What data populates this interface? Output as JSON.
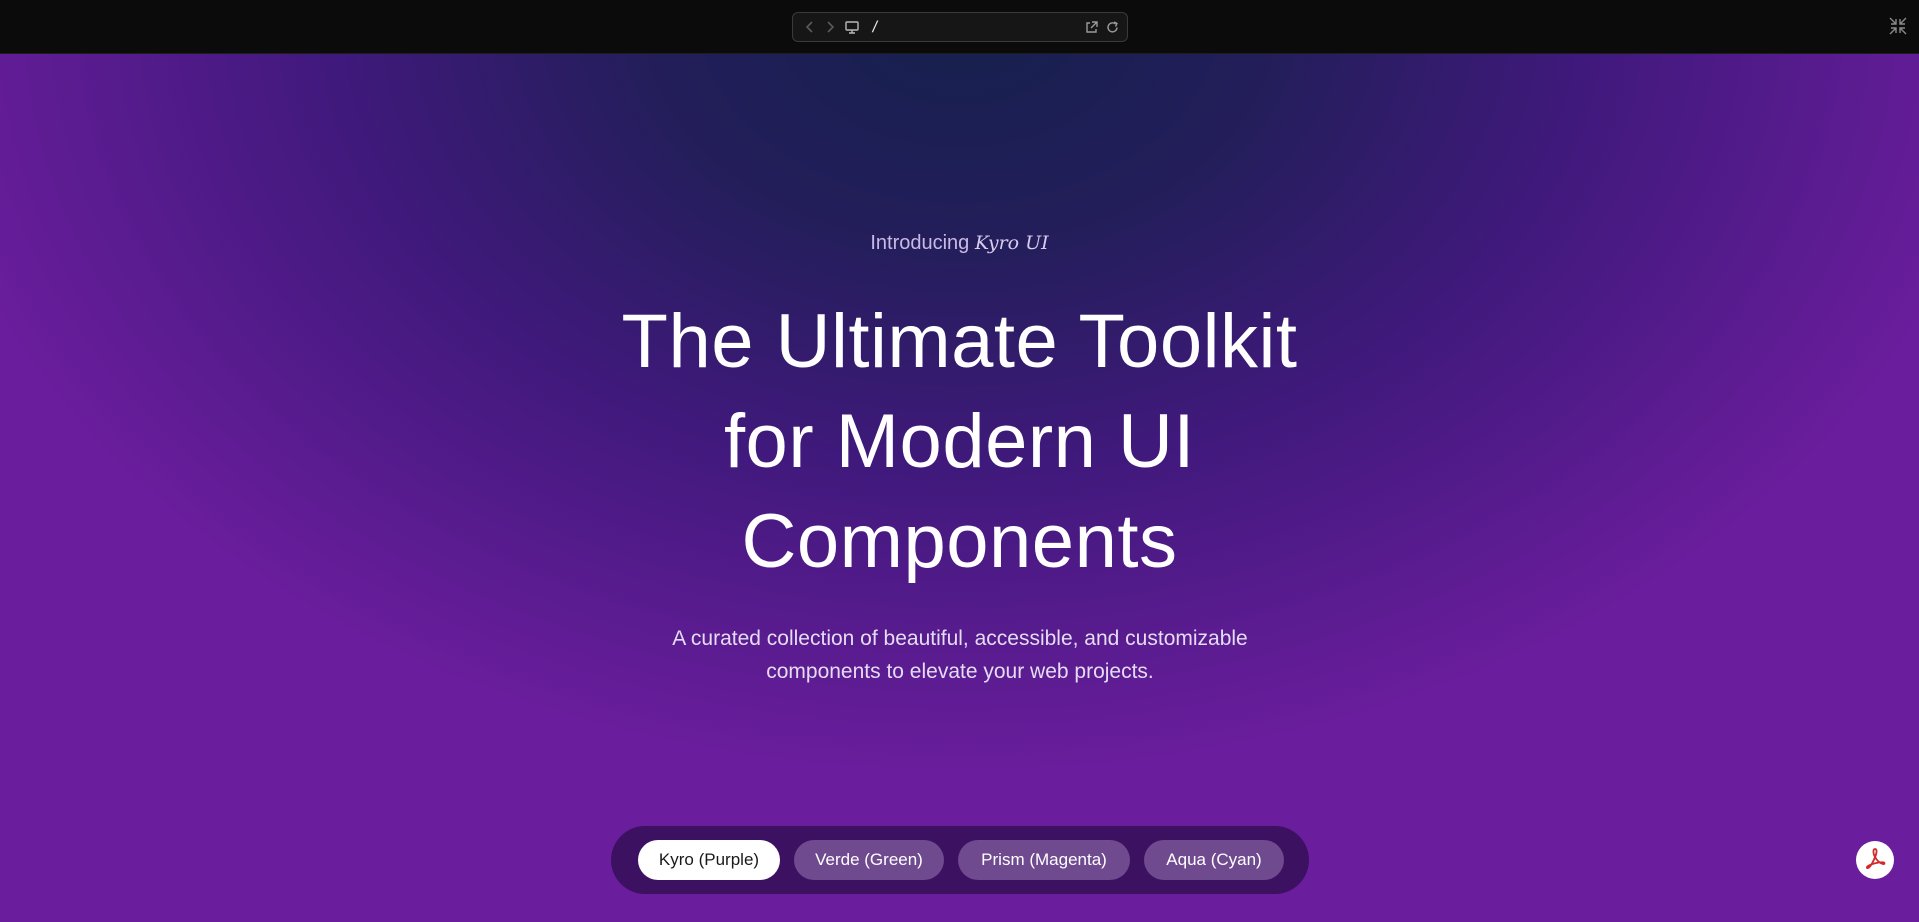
{
  "browser": {
    "url": "/"
  },
  "hero": {
    "eyebrow_prefix": "Introducing",
    "eyebrow_brand": "Kyro UI",
    "title_line1": "The Ultimate Toolkit",
    "title_line2": "for Modern UI",
    "title_line3": "Components",
    "subtitle_line1": "A curated collection of beautiful, accessible, and customizable",
    "subtitle_line2": "components to elevate your web projects."
  },
  "themes": {
    "items": [
      {
        "label": "Kyro (Purple)",
        "active": true
      },
      {
        "label": "Verde (Green)",
        "active": false
      },
      {
        "label": "Prism (Magenta)",
        "active": false
      },
      {
        "label": "Aqua (Cyan)",
        "active": false
      }
    ]
  },
  "colors": {
    "background_outer": "#6a1d9c",
    "background_center": "#15204d",
    "switcher_bg": "#3d1162",
    "active_button_bg": "#ffffff",
    "inactive_button_bg": "#6f4a8f",
    "pdf_icon": "#d12a2a"
  },
  "icons": {
    "back": "chevron-left-icon",
    "forward": "chevron-right-icon",
    "device": "monitor-icon",
    "open_external": "external-link-icon",
    "reload": "refresh-icon",
    "collapse": "minimize-icon",
    "pdf": "acrobat-pdf-icon"
  }
}
